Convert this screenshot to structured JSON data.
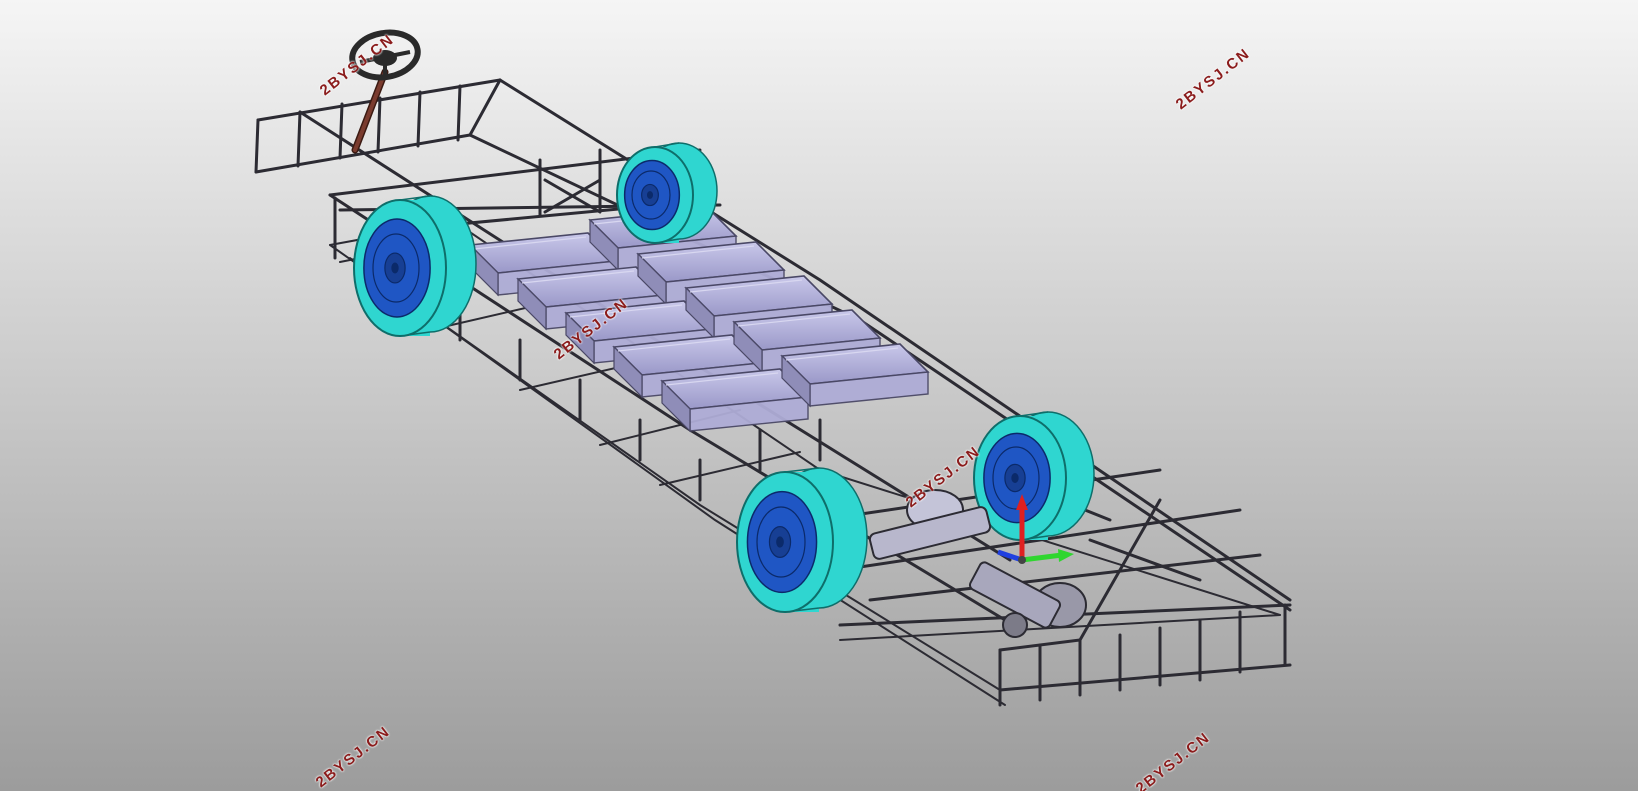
{
  "viewport": {
    "background_top": "#f5f5f5",
    "background_bottom": "#9c9c9c"
  },
  "model": {
    "name": "bus-chassis-assembly",
    "frame_color": "#6e6c7a",
    "frame_edge_color": "#2c2b33",
    "battery_color": "#aeacd6",
    "battery_edge_color": "#4a4866",
    "tire_color": "#2fd6d0",
    "tire_edge_color": "#0e6e6a",
    "rim_color": "#1f56c4",
    "rim_edge_color": "#0b2a6a",
    "steering_wheel_color": "#2a2a2a",
    "steering_column_color": "#7a3b2e",
    "battery_pack_count": 10
  },
  "triad": {
    "x_axis_color": "#2fd62f",
    "y_axis_color": "#e02020",
    "z_axis_color": "#2040e0"
  },
  "watermarks": {
    "text": "2BYSJ.CN",
    "color": "#8b1c1c"
  }
}
